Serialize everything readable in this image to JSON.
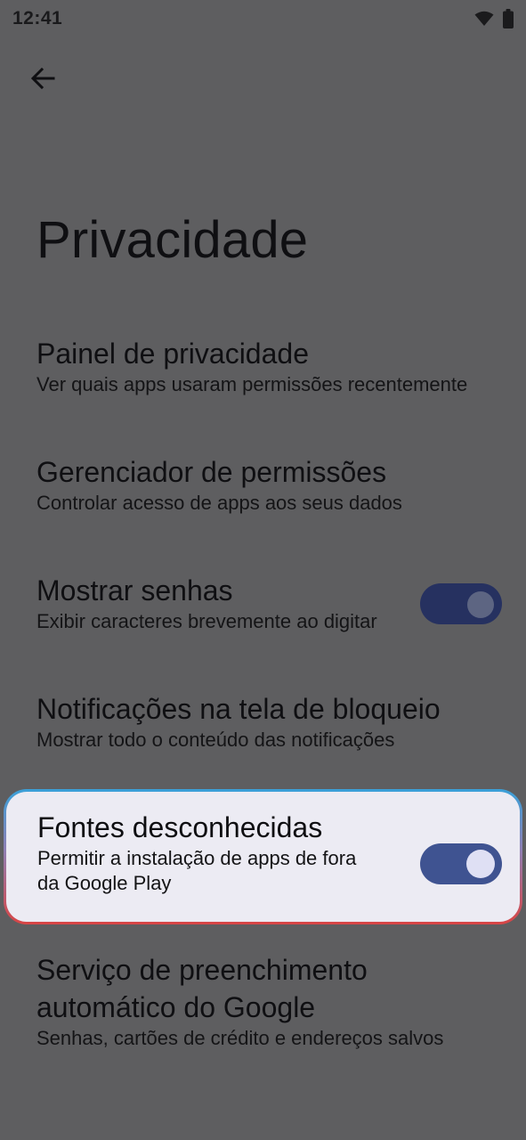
{
  "status": {
    "time": "12:41",
    "wifi_icon": "wifi-icon",
    "battery_icon": "battery-icon"
  },
  "header": {
    "back_icon": "back-arrow-icon",
    "title": "Privacidade"
  },
  "items": [
    {
      "title": "Painel de privacidade",
      "subtitle": "Ver quais apps usaram permissões recentemente"
    },
    {
      "title": "Gerenciador de permissões",
      "subtitle": "Controlar acesso de apps aos seus dados"
    },
    {
      "title": "Mostrar senhas",
      "subtitle": "Exibir caracteres brevemente ao digitar",
      "toggle": true
    },
    {
      "title": "Notificações na tela de bloqueio",
      "subtitle": "Mostrar todo o conteúdo das notificações"
    },
    {
      "title": "Fontes desconhecidas",
      "subtitle_line1": "Permitir a instalação de apps de fora",
      "subtitle_line2": "da Google Play",
      "toggle": true,
      "highlighted": true
    },
    {
      "title_line1": "Serviço de preenchimento",
      "title_line2": "automático do Google",
      "subtitle": "Senhas, cartões de crédito e endereços salvos"
    }
  ],
  "colors": {
    "scrim_background": "#5e5e60",
    "highlight_card": "#ecebf3",
    "toggle_track_dim": "#263160",
    "toggle_track_active": "#3f5391",
    "toggle_knob": "#dfe0f4",
    "highlight_border_top": "#3aa0d8",
    "highlight_border_bottom": "#d84545"
  }
}
